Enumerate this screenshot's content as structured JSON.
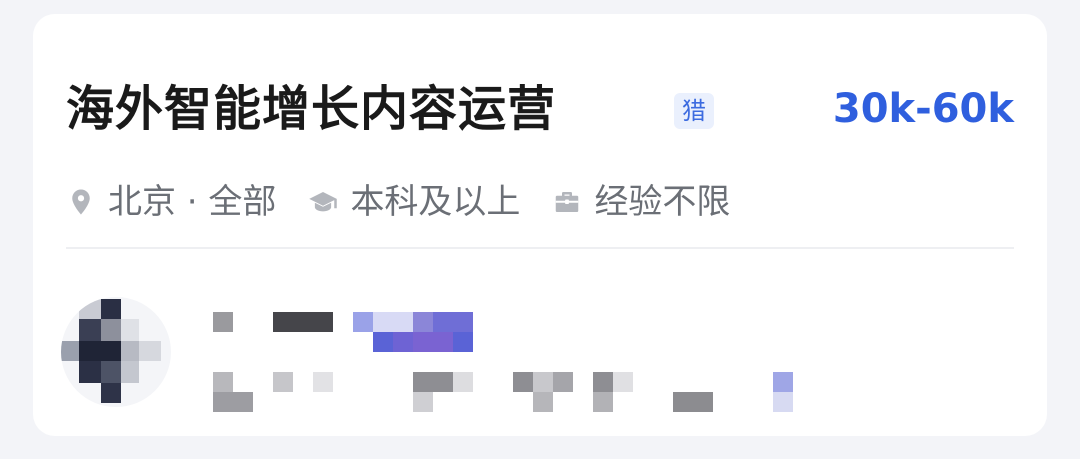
{
  "job": {
    "title": "海外智能增长内容运营",
    "badge": "猎",
    "salary": "30k-60k"
  },
  "meta": {
    "location": "北京 · 全部",
    "education": "本科及以上",
    "experience": "经验不限"
  },
  "icons": {
    "location": "location-pin-icon",
    "education": "graduation-cap-icon",
    "experience": "briefcase-icon"
  },
  "colors": {
    "salary": "#2f5fde",
    "badge_bg": "#eaf0fd",
    "badge_text": "#3c6be0",
    "meta_text": "#6b6f76",
    "title_text": "#1a1a1a"
  }
}
